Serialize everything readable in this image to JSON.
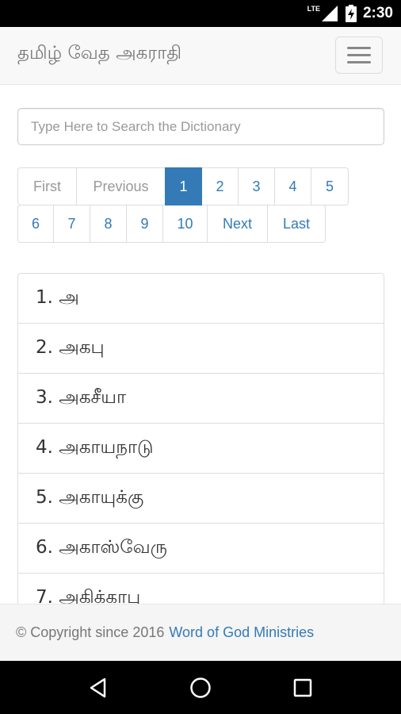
{
  "status_bar": {
    "network": "LTE",
    "time": "2:30"
  },
  "navbar": {
    "brand": "தமிழ் வேத அகராதி"
  },
  "search": {
    "placeholder": "Type Here to Search the Dictionary",
    "value": ""
  },
  "pagination": {
    "row1": [
      "First",
      "Previous",
      "1",
      "2",
      "3",
      "4",
      "5"
    ],
    "row2": [
      "6",
      "7",
      "8",
      "9",
      "10",
      "Next",
      "Last"
    ],
    "active": "1",
    "disabled": [
      "First",
      "Previous"
    ]
  },
  "entries": [
    "1. அ",
    "2. அகபு",
    "3. அகசீயா",
    "4. அகாயநாடு",
    "5. அகாயுக்கு",
    "6. அகாஸ்வேரு",
    "7. அகிக்காபு"
  ],
  "footer": {
    "copyright": "© Copyright since 2016",
    "link": "Word of God Ministries"
  },
  "colors": {
    "primary": "#337ab7",
    "navbar_bg": "#f8f8f8",
    "footer_bg": "#f5f5f5"
  },
  "icons": {
    "status": [
      "signal-icon",
      "battery-icon"
    ],
    "nav": [
      "back-icon",
      "home-icon",
      "recents-icon"
    ],
    "menu": "hamburger-menu-icon"
  }
}
